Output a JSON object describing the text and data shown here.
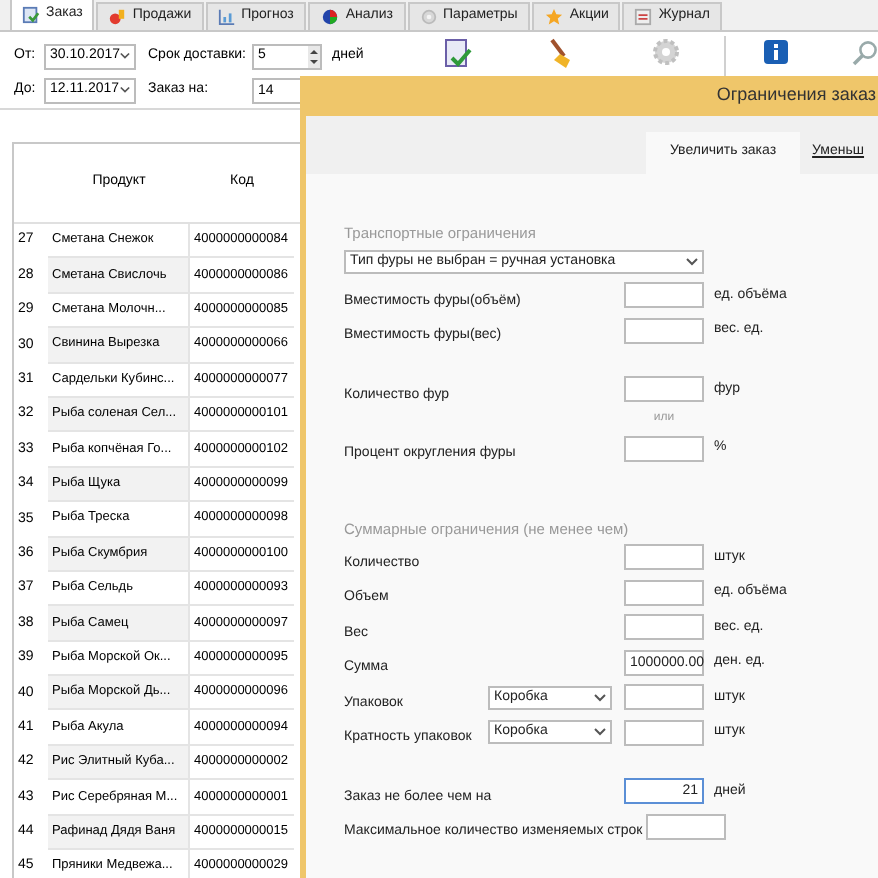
{
  "tabs": [
    {
      "label": "Заказ",
      "selected": true
    },
    {
      "label": "Продажи",
      "selected": false
    },
    {
      "label": "Прогноз",
      "selected": false
    },
    {
      "label": "Анализ",
      "selected": false
    },
    {
      "label": "Параметры",
      "selected": false
    },
    {
      "label": "Акции",
      "selected": false
    },
    {
      "label": "Журнал",
      "selected": false
    }
  ],
  "toolbar": {
    "from_label": "От:",
    "from_date": "30.10.2017",
    "to_label": "До:",
    "to_date": "12.11.2017",
    "delivery_label": "Срок доставки:",
    "delivery_value": "5",
    "delivery_unit": "дней",
    "order_for_label": "Заказ на:",
    "order_for_value": "14"
  },
  "table": {
    "columns": [
      "Продукт",
      "Код"
    ],
    "rows": [
      {
        "n": "27",
        "product": "Сметана Снежок",
        "code": "4000000000084"
      },
      {
        "n": "28",
        "product": "Сметана Свислочь",
        "code": "4000000000086"
      },
      {
        "n": "29",
        "product": "Сметана Молочн...",
        "code": "4000000000085"
      },
      {
        "n": "30",
        "product": "Свинина Вырезка",
        "code": "4000000000066"
      },
      {
        "n": "31",
        "product": "Сардельки Кубинс...",
        "code": "4000000000077"
      },
      {
        "n": "32",
        "product": "Рыба соленая Сел...",
        "code": "4000000000101"
      },
      {
        "n": "33",
        "product": "Рыба копчёная Го...",
        "code": "4000000000102"
      },
      {
        "n": "34",
        "product": "Рыба Щука",
        "code": "4000000000099"
      },
      {
        "n": "35",
        "product": "Рыба Треска",
        "code": "4000000000098"
      },
      {
        "n": "36",
        "product": "Рыба Скумбрия",
        "code": "4000000000100"
      },
      {
        "n": "37",
        "product": "Рыба Сельдь",
        "code": "4000000000093"
      },
      {
        "n": "38",
        "product": "Рыба Самец",
        "code": "4000000000097"
      },
      {
        "n": "39",
        "product": "Рыба Морской Ок...",
        "code": "4000000000095"
      },
      {
        "n": "40",
        "product": "Рыба Морской Дь...",
        "code": "4000000000096"
      },
      {
        "n": "41",
        "product": "Рыба Акула",
        "code": "4000000000094"
      },
      {
        "n": "42",
        "product": "Рис Элитный Куба...",
        "code": "4000000000002"
      },
      {
        "n": "43",
        "product": "Рис Серебряная М...",
        "code": "4000000000001"
      },
      {
        "n": "44",
        "product": "Рафинад Дядя Ваня",
        "code": "4000000000015"
      },
      {
        "n": "45",
        "product": "Пряники Медвежа...",
        "code": "4000000000029"
      }
    ]
  },
  "dialog": {
    "title": "Ограничения заказ",
    "tabs": [
      {
        "label": "Увеличить заказ",
        "selected": true
      },
      {
        "label": "Уменьш",
        "selected": false
      }
    ],
    "transport": {
      "heading": "Транспортные ограничения",
      "truck_type": "Тип фуры не выбран = ручная установка",
      "rows": [
        {
          "kind": "field",
          "label": "Вместимость фуры(объём)",
          "unit": "ед. объёма"
        },
        {
          "kind": "field",
          "label": "Вместимость фуры(вес)",
          "unit": "вес. ед."
        },
        {
          "kind": "gap"
        },
        {
          "kind": "field",
          "label": "Количество фур",
          "unit": "фур"
        },
        {
          "kind": "note",
          "label": "или"
        },
        {
          "kind": "field",
          "label": "Процент округления фуры",
          "unit": "%"
        }
      ]
    },
    "totals": {
      "heading": "Суммарные ограничения (не менее чем)",
      "rows": [
        {
          "kind": "field",
          "label": "Количество",
          "unit": "штук"
        },
        {
          "kind": "field",
          "label": "Объем",
          "unit": "ед. объёма"
        },
        {
          "kind": "field",
          "label": "Вес",
          "unit": "вес. ед."
        },
        {
          "kind": "field",
          "label": "Сумма",
          "value": "1000000.00",
          "unit": "ден. ед."
        },
        {
          "kind": "select",
          "label": "Упаковок",
          "option": "Коробка",
          "unit": "штук"
        },
        {
          "kind": "select",
          "label": "Кратность упаковок",
          "option": "Коробка",
          "unit": "штук"
        },
        {
          "kind": "gap"
        },
        {
          "kind": "field",
          "label": "Заказ не более чем на",
          "value": "21",
          "unit": "дней",
          "focused": true
        },
        {
          "kind": "field",
          "label": "Максимальное количество изменяемых строк"
        }
      ]
    }
  }
}
